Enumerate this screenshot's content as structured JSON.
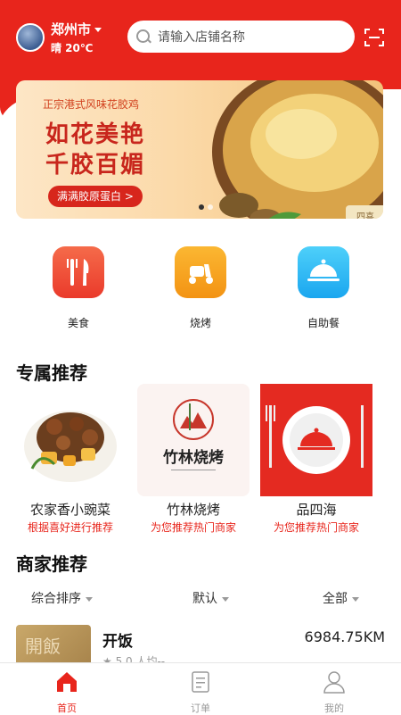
{
  "header": {
    "city": "郑州市",
    "weather": "晴 20℃",
    "search_placeholder": "请输入店铺名称"
  },
  "banner": {
    "subtitle": "正宗港式风味花胶鸡",
    "title_line1": "如花美艳",
    "title_line2": "千胶百媚",
    "button": "满满胶原蛋白 >",
    "box_text": "四喜",
    "active_dot": 1,
    "dot_count": 2
  },
  "categories": [
    {
      "label": "美食",
      "icon": "fork-knife-icon",
      "color": "#f2543a"
    },
    {
      "label": "烧烤",
      "icon": "scooter-icon",
      "color": "#f7a41a"
    },
    {
      "label": "自助餐",
      "icon": "food-cloche-icon",
      "color": "#2fbcf5"
    }
  ],
  "exclusive": {
    "title": "专属推荐",
    "items": [
      {
        "name": "农家香小豌菜",
        "sub": "根据喜好进行推荐"
      },
      {
        "name": "竹林烧烤",
        "sub": "为您推荐热门商家",
        "logo_text": "竹林烧烤"
      },
      {
        "name": "品四海",
        "sub": "为您推荐热门商家"
      }
    ]
  },
  "merchants": {
    "title": "商家推荐",
    "sort": {
      "default_order": "综合排序",
      "default": "默认",
      "all": "全部"
    },
    "list": [
      {
        "name": "开饭",
        "distance": "6984.75KM",
        "rating": "★ 5.0  人均--",
        "image_text": "開飯"
      }
    ]
  },
  "tabbar": [
    {
      "label": "首页",
      "icon": "home-icon",
      "active": true
    },
    {
      "label": "订单",
      "icon": "order-icon",
      "active": false
    },
    {
      "label": "我的",
      "icon": "user-icon",
      "active": false
    }
  ],
  "colors": {
    "brand": "#e8251c",
    "active_tab": "#e8251c",
    "inactive_tab": "#999999"
  }
}
